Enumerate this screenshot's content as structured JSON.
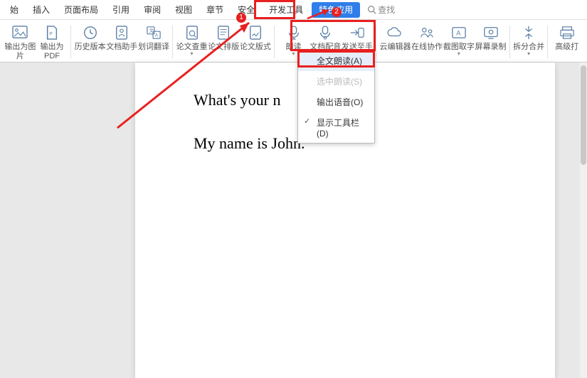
{
  "tabs": {
    "t0": "始",
    "t1": "插入",
    "t2": "页面布局",
    "t3": "引用",
    "t4": "审阅",
    "t5": "视图",
    "t6": "章节",
    "t7": "安全",
    "t8": "开发工具",
    "t9": "特色应用"
  },
  "search": {
    "placeholder": "查找"
  },
  "ribbon": {
    "r0": "输出为图片",
    "r1": "输出为PDF",
    "r2": "历史版本",
    "r3": "文档助手",
    "r4": "划词翻译",
    "r5": "论文查重",
    "r6": "论文排版",
    "r7": "论文版式",
    "r8": "朗读",
    "r9": "文档配音",
    "r10": "发送至手机",
    "r11": "云编辑器",
    "r12": "在线协作",
    "r13": "截图取字",
    "r14": "屏幕录制",
    "r15": "拆分合并",
    "r16": "高级打"
  },
  "dropdown": {
    "d0": "全文朗读(A)",
    "d1": "选中朗读(S)",
    "d2": "输出语音(O)",
    "d3": "显示工具栏(D)"
  },
  "document": {
    "line1": "What's your n",
    "line2": "My name is John."
  },
  "anno": {
    "n1": "1",
    "n2": "2"
  }
}
